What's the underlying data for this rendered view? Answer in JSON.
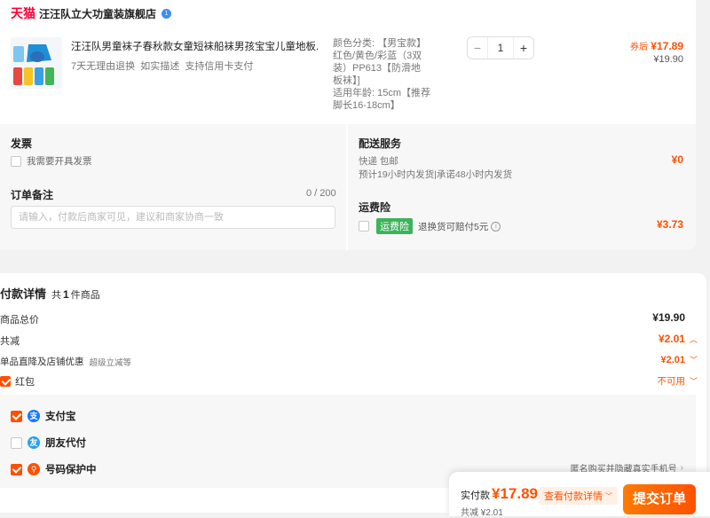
{
  "store": {
    "platform_logo": "天猫",
    "name": "汪汪队立大功童装旗舰店",
    "verified_icon": "shield-badge-icon"
  },
  "product": {
    "title": "汪汪队男童袜子春秋款女童短袜船袜男孩宝宝儿童地板...",
    "services": "7天无理由退换  如实描述  支持信用卡支付",
    "spec": "颜色分类: 【男宝款】红色/黄色/彩蓝（3双装）PP613【防滑地板袜】]",
    "age": "适用年龄: 15cm【推荐脚长16-18cm】",
    "quantity": "1",
    "qty_minus": "−",
    "qty_plus": "+",
    "price_label": "券后",
    "price": "¥17.89",
    "original_price": "¥19.90"
  },
  "invoice": {
    "title": "发票",
    "option": "我需要开具发票"
  },
  "remark": {
    "title": "订单备注",
    "counter": "0 / 200",
    "placeholder": "请输入，付款后商家可见，建议和商家协商一致"
  },
  "delivery": {
    "title": "配送服务",
    "method": "快递 包邮",
    "estimate": "预计19小时内发货|承诺48小时内发货",
    "fee": "¥0"
  },
  "insurance": {
    "title": "运费险",
    "badge": "运费险",
    "desc": "退换货可赔付5元",
    "price": "¥3.73"
  },
  "payment": {
    "title": "付款详情",
    "count_prefix": "共",
    "count": "1",
    "count_suffix": "件商品",
    "total_label": "商品总价",
    "total": "¥19.90",
    "discount_label": "共减",
    "discount": "¥2.01",
    "promo_label": "单品直降及店铺优惠",
    "promo_tag": "超级立减等",
    "promo_value": "¥2.01",
    "redpacket_label": "红包",
    "redpacket_status": "不可用",
    "methods": [
      {
        "name": "支付宝",
        "checked": true,
        "icon": "alipay-icon"
      },
      {
        "name": "朋友代付",
        "checked": false,
        "icon": "friend-pay-icon"
      },
      {
        "name": "号码保护中",
        "checked": true,
        "icon": "number-protect-icon"
      }
    ],
    "anon_note": "匿名购买并隐藏真实手机号"
  },
  "footer": {
    "actual_label": "实付款",
    "actual_amount": "¥17.89",
    "detail_btn": "查看付款详情",
    "saved": "共减 ¥2.01",
    "submit": "提交订单"
  },
  "colors": {
    "accent": "#ff5000",
    "green": "#3db35c"
  }
}
